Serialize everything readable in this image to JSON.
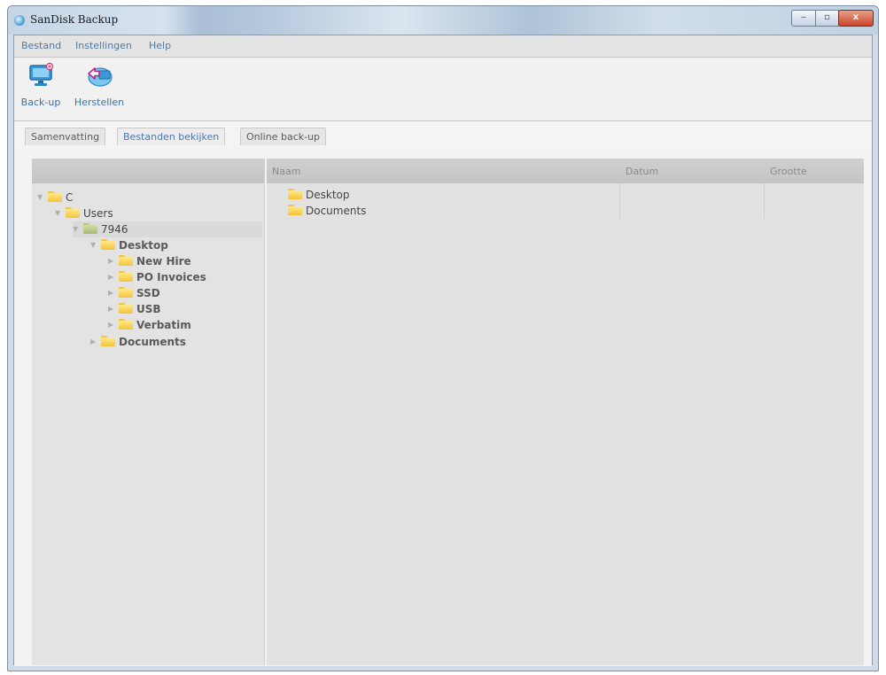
{
  "window": {
    "title": "SanDisk Backup"
  },
  "controls": {
    "minimize": "‒",
    "maximize": "▫",
    "close": "x"
  },
  "menu": [
    {
      "label": "Bestand"
    },
    {
      "label": "Instellingen"
    },
    {
      "label": "Help"
    }
  ],
  "toolbar": [
    {
      "label": "Back-up",
      "icon": "monitor-icon"
    },
    {
      "label": "Herstellen",
      "icon": "restore-arrow-icon"
    }
  ],
  "tabs": [
    {
      "label": "Samenvatting",
      "active": false
    },
    {
      "label": "Bestanden bekijken",
      "active": true
    },
    {
      "label": "Online back-up",
      "active": false
    }
  ],
  "tree": [
    {
      "label": "C"
    },
    {
      "label": "Users"
    },
    {
      "label": "7946"
    },
    {
      "label": "Desktop"
    },
    {
      "label": "New Hire"
    },
    {
      "label": "PO Invoices"
    },
    {
      "label": "SSD"
    },
    {
      "label": "USB"
    },
    {
      "label": "Verbatim"
    },
    {
      "label": "Documents"
    }
  ],
  "list": {
    "columns": [
      "Naam",
      "Datum",
      "Grootte"
    ],
    "rows": [
      {
        "name": "Desktop"
      },
      {
        "name": "Documents"
      }
    ]
  },
  "colors": {
    "accent_text": "#4d78a8",
    "close_button": "#c9462b",
    "folder": "#f3c43a"
  }
}
